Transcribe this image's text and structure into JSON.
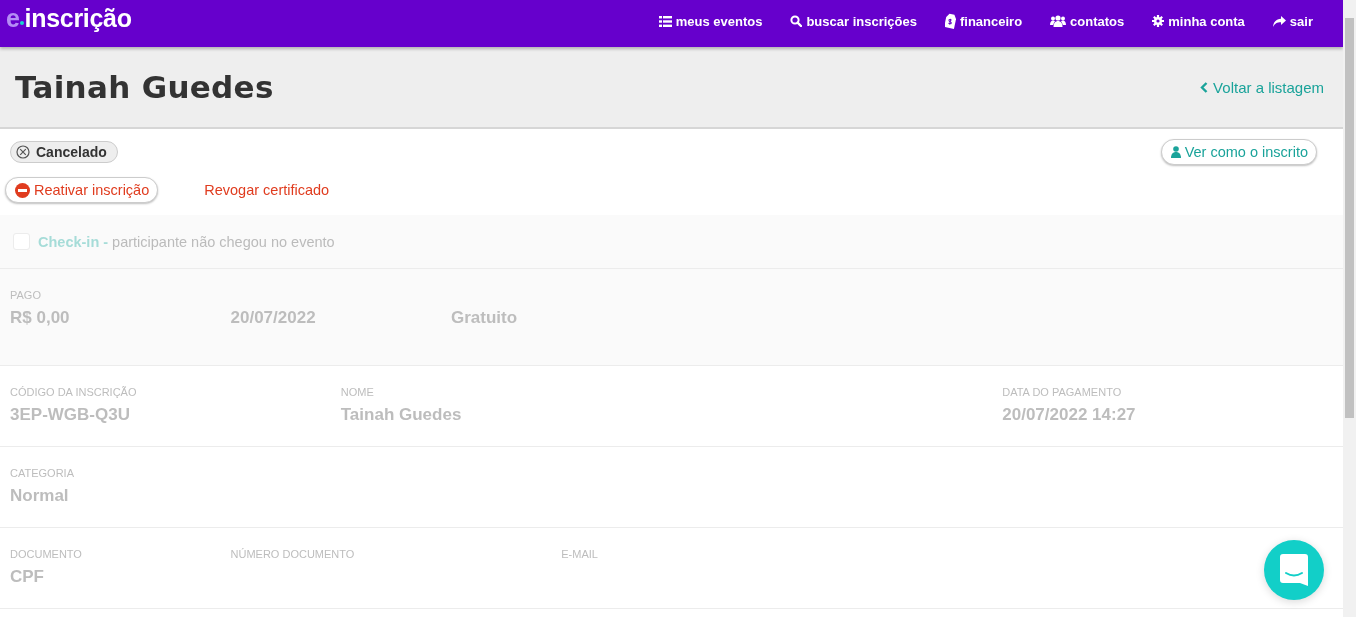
{
  "brand": {
    "prefix": "e",
    "name": "inscrição"
  },
  "nav": [
    {
      "label": "meus eventos"
    },
    {
      "label": "buscar inscrições"
    },
    {
      "label": "financeiro"
    },
    {
      "label": "contatos"
    },
    {
      "label": "minha conta"
    },
    {
      "label": "sair"
    }
  ],
  "header": {
    "title": "Tainah Guedes",
    "back_link": "Voltar a listagem"
  },
  "status_badge": "Cancelado",
  "view_as_button": "Ver como o inscrito",
  "reactivate_button": "Reativar inscrição",
  "revoke_link": "Revogar certificado",
  "checkin": {
    "label": "Check-in -",
    "text": "participante não chegou no evento",
    "checked": false
  },
  "rows": [
    {
      "shaded": true,
      "fields": [
        {
          "label": "PAGO",
          "value": "R$ 0,00"
        },
        {
          "value": "20/07/2022"
        },
        {
          "value": "Gratuito"
        }
      ]
    },
    {
      "shaded": false,
      "fields": [
        {
          "label": "CÓDIGO DA INSCRIÇÃO",
          "value": "3EP-WGB-Q3U"
        },
        {
          "label": "NOME",
          "value": "Tainah Guedes"
        },
        {
          "label": "DATA DO PAGAMENTO",
          "value": "20/07/2022 14:27"
        }
      ]
    },
    {
      "shaded": false,
      "fields": [
        {
          "label": "CATEGORIA",
          "value": "Normal"
        }
      ]
    },
    {
      "shaded": false,
      "fields": [
        {
          "label": "DOCUMENTO",
          "value": "CPF"
        },
        {
          "label": "NÚMERO DOCUMENTO"
        },
        {
          "label": "E-MAIL"
        }
      ]
    }
  ]
}
